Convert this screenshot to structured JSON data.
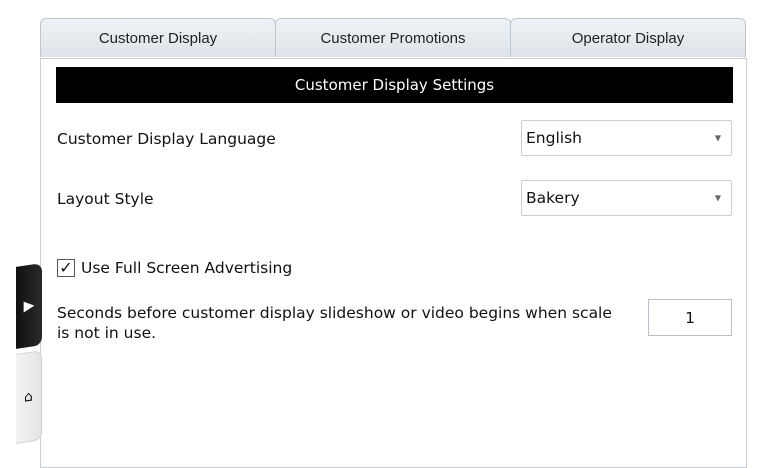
{
  "tabs": [
    {
      "label": "Customer Display"
    },
    {
      "label": "Customer Promotions"
    },
    {
      "label": "Operator Display"
    }
  ],
  "section_title": "Customer Display Settings",
  "settings": {
    "language": {
      "label": "Customer Display Language",
      "value": "English"
    },
    "layout": {
      "label": "Layout Style",
      "value": "Bakery"
    },
    "full_screen_ads": {
      "label": "Use Full Screen Advertising",
      "checked": true,
      "check_glyph": "✓"
    },
    "slideshow_delay": {
      "label": "Seconds before customer display slideshow or video begins when scale is not in use.",
      "value": "1"
    }
  },
  "side_handles": {
    "expand_icon": "arrow-right-icon",
    "expand_glyph": "▶",
    "home_icon": "home-icon",
    "home_glyph": "⌂"
  }
}
